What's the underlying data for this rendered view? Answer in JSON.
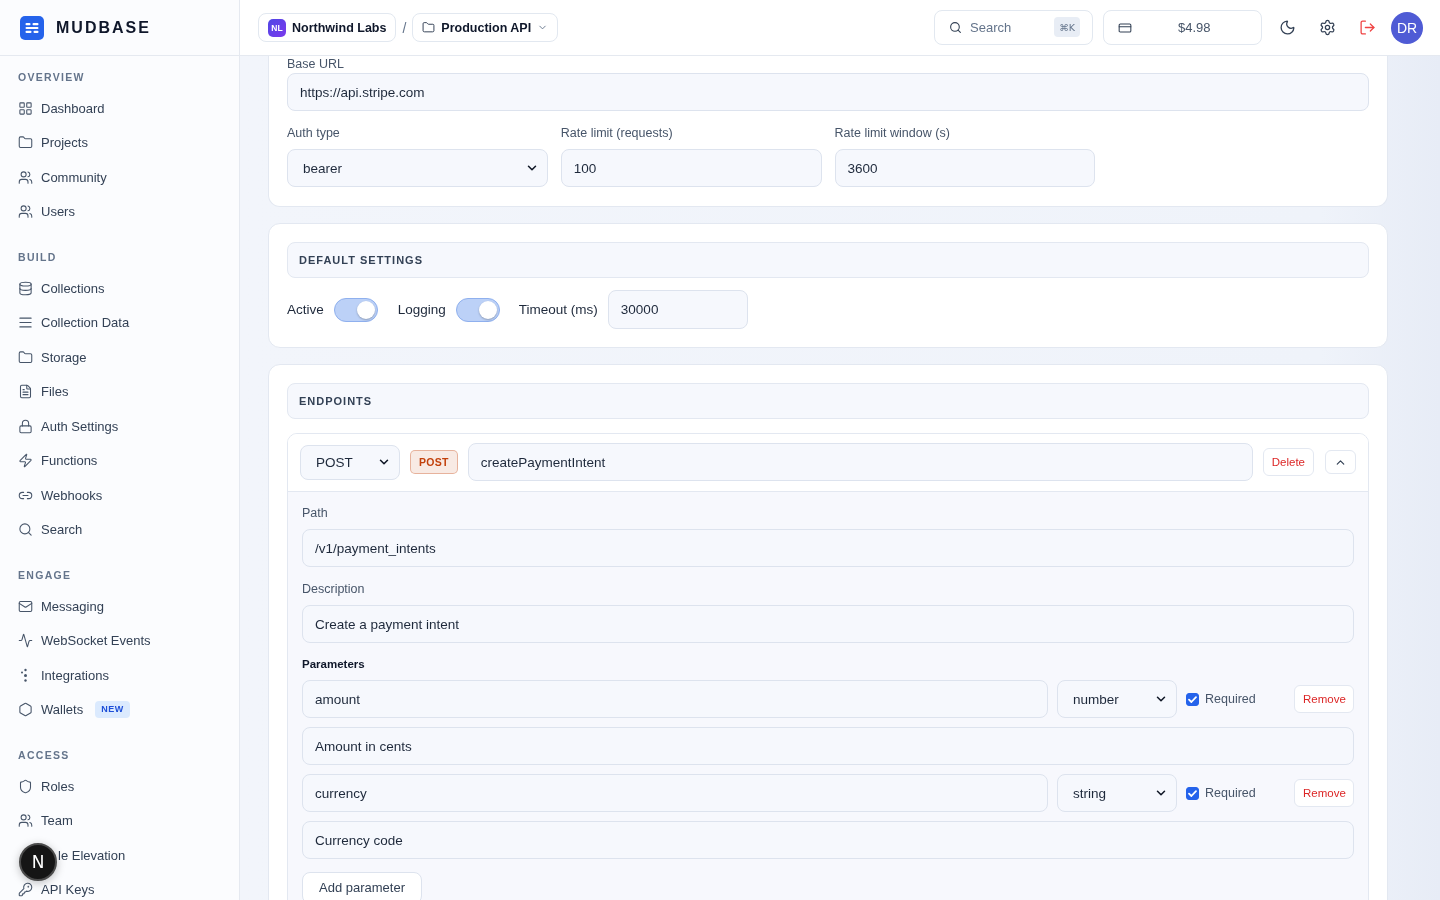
{
  "sidebar": {
    "brand": "MUDBASE",
    "sections": [
      {
        "title": "OVERVIEW",
        "items": [
          {
            "label": "Dashboard",
            "kind": "nav"
          },
          {
            "label": "Projects",
            "kind": "nav"
          },
          {
            "label": "Community",
            "kind": "nav"
          },
          {
            "label": "Users",
            "kind": "nav"
          }
        ]
      },
      {
        "title": "BUILD",
        "items": [
          {
            "label": "Collections",
            "kind": "nav"
          },
          {
            "label": "Collection Data",
            "kind": "nav"
          },
          {
            "label": "Storage",
            "kind": "nav"
          },
          {
            "label": "Files",
            "kind": "nav"
          },
          {
            "label": "Auth Settings",
            "kind": "nav"
          },
          {
            "label": "Functions",
            "kind": "nav"
          },
          {
            "label": "Webhooks",
            "kind": "nav"
          },
          {
            "label": "Search",
            "kind": "nav"
          }
        ]
      },
      {
        "title": "ENGAGE",
        "items": [
          {
            "label": "Messaging",
            "kind": "nav"
          },
          {
            "label": "WebSocket Events",
            "kind": "nav"
          },
          {
            "label": "Integrations",
            "kind": "nav"
          },
          {
            "label": "Wallets",
            "kind": "nav",
            "badge": "NEW"
          }
        ]
      },
      {
        "title": "ACCESS",
        "items": [
          {
            "label": "Roles",
            "kind": "nav"
          },
          {
            "label": "Team",
            "kind": "nav"
          },
          {
            "label": "le Elevation",
            "kind": "covered"
          },
          {
            "label": "API Keys",
            "kind": "nav"
          }
        ]
      }
    ]
  },
  "dev_tools": {
    "label": "N"
  },
  "header": {
    "breadcrumb": [
      {
        "kind": "workspace",
        "badge": "NL",
        "label": "Northwind Labs"
      },
      {
        "kind": "project",
        "label": "Production API"
      }
    ],
    "separator": "/",
    "search": {
      "placeholder": "Search",
      "shortcut": "⌘K"
    },
    "balance": "$4.98",
    "avatar": "DR"
  },
  "connection": {
    "base_url": {
      "label": "Base URL",
      "value": "https://api.stripe.com"
    },
    "fields": [
      {
        "kind": "select",
        "label": "Auth type",
        "value": "bearer"
      },
      {
        "kind": "input",
        "label": "Rate limit (requests)",
        "value": "100"
      },
      {
        "kind": "input",
        "label": "Rate limit window (s)",
        "value": "3600"
      }
    ]
  },
  "default_settings": {
    "title": "DEFAULT SETTINGS",
    "toggles": [
      {
        "label": "Active",
        "on": true
      },
      {
        "label": "Logging",
        "on": true
      }
    ],
    "timeout": {
      "label": "Timeout (ms)",
      "value": "30000"
    }
  },
  "endpoints": {
    "title": "ENDPOINTS",
    "items": [
      {
        "method": "POST",
        "badge": "POST",
        "color": "#c2410c",
        "name": "createPaymentIntent",
        "delete_label": "Delete",
        "expanded": true,
        "path": {
          "label": "Path",
          "value": "/v1/payment_intents"
        },
        "description": {
          "label": "Description",
          "value": "Create a payment intent"
        },
        "parameters_title": "Parameters",
        "parameters": [
          {
            "name": "amount",
            "type": "number",
            "required": true,
            "required_label": "Required",
            "remove_label": "Remove",
            "description": "Amount in cents"
          },
          {
            "name": "currency",
            "type": "string",
            "required": true,
            "required_label": "Required",
            "remove_label": "Remove",
            "description": "Currency code"
          }
        ],
        "add_parameter_label": "Add parameter"
      }
    ]
  }
}
